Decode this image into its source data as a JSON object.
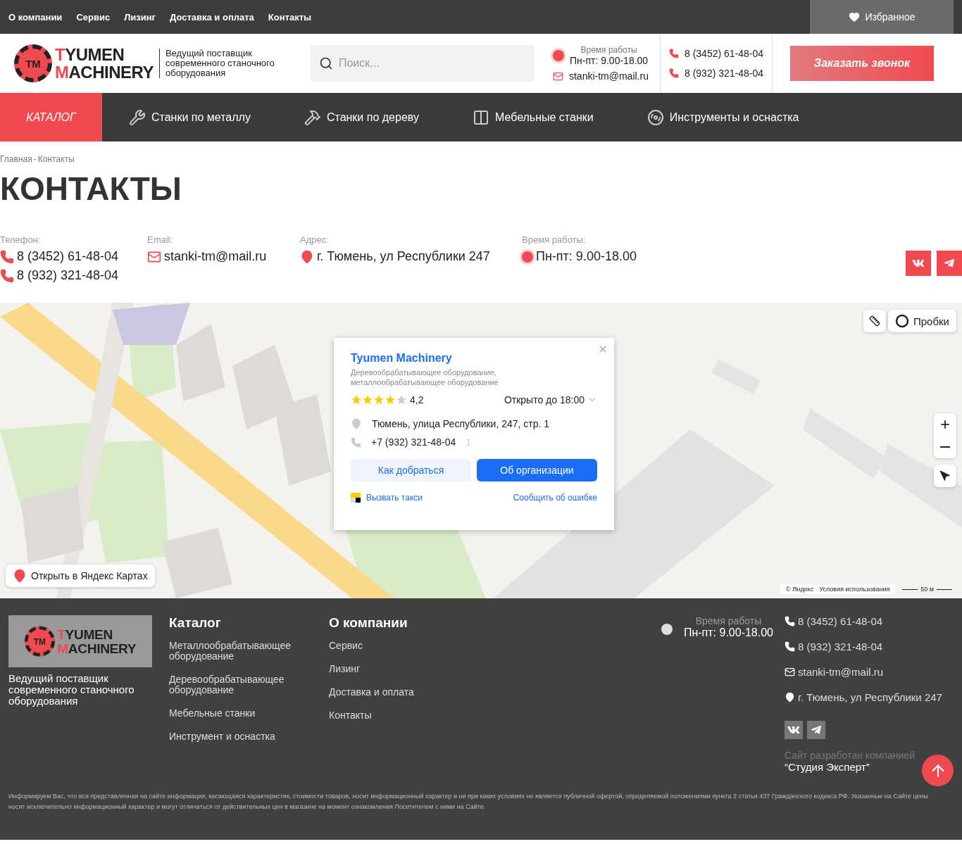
{
  "top_menu": [
    {
      "label": "О компании"
    },
    {
      "label": "Сервис"
    },
    {
      "label": "Лизинг"
    },
    {
      "label": "Доставка и оплата"
    },
    {
      "label": "Контакты"
    }
  ],
  "favorites": {
    "label": "Избранное"
  },
  "logo": {
    "badge": "TM",
    "line1": "TYUMEN",
    "line2": "MACHINERY"
  },
  "tagline": "Ведущий поставщик современного станочного оборудования",
  "search": {
    "placeholder": "Поиск..."
  },
  "work_hours": {
    "label": "Время работы",
    "value": "Пн-пт: 9.00-18.00"
  },
  "email": "stanki-tm@mail.ru",
  "phones": [
    "8 (3452) 61-48-04",
    "8 (932) 321-48-04"
  ],
  "callback_button": "Заказать звонок",
  "catalog_button": "КАТАЛОГ",
  "nav": [
    {
      "label": "Станки по металлу",
      "kind": "metal"
    },
    {
      "label": "Станки по дереву",
      "kind": "wood"
    },
    {
      "label": "Мебельные станки",
      "kind": "furniture"
    },
    {
      "label": "Инструменты и оснастка",
      "kind": "tools"
    }
  ],
  "breadcrumbs": {
    "items": [
      "Главная",
      "Контакты"
    ],
    "separator": "-"
  },
  "page_title": "КОНТАКТЫ",
  "contacts": [
    {
      "kind": "phone",
      "label": "Телефон:",
      "values": [
        "8 (3452) 61-48-04",
        "8 (932) 321-48-04"
      ]
    },
    {
      "kind": "email",
      "label": "Email:",
      "values": [
        "stanki-tm@mail.ru"
      ]
    },
    {
      "kind": "address",
      "label": "Адрес:",
      "values": [
        "г. Тюмень, ул Республики 247"
      ]
    },
    {
      "kind": "hours",
      "label": "Время работы:",
      "values": [
        "Пн-пт: 9.00-18.00"
      ]
    }
  ],
  "social": [
    {
      "kind": "vk"
    },
    {
      "kind": "telegram"
    }
  ],
  "map": {
    "kind": "picture",
    "org_card": {
      "title": "Tyumen Machinery",
      "description": "Деревообрабатывающее оборудование, металлообрабатывающее оборудование",
      "stars": 4,
      "rating": "4,2",
      "hours": "Открыто до 18:00",
      "address": "Тюмень, улица Республики, 247, стр. 1",
      "phone": "+7 (932) 321-48-04",
      "phone_count": "1",
      "buttons": [
        {
          "label": "Как добраться",
          "kind": "secondary"
        },
        {
          "label": "Об организации",
          "kind": "primary"
        }
      ],
      "taxi": "Вызвать такси",
      "report": "Сообщить об ошибке"
    },
    "traffic": "Пробки",
    "open_link": "Открыть в Яндекс Картах",
    "copyright": "© Яндекс",
    "terms": "Условия использования",
    "scale": "50 м"
  },
  "footer": {
    "logo": {
      "badge": "TM",
      "line1": "TYUMEN",
      "line2": "MACHINERY"
    },
    "tagline": "Ведущий поставщик современного станочного оборудования",
    "columns": [
      {
        "title": "Каталог",
        "links": [
          "Металлообрабатывающее оборудование",
          "Деревообрабатывающее оборудование",
          "Мебельные станки",
          "Инструмент и оснастка"
        ]
      },
      {
        "title": "О компании",
        "links": [
          "Сервис",
          "Лизинг",
          "Доставка и оплата",
          "Контакты"
        ]
      }
    ],
    "work_hours": {
      "label": "Время работы",
      "value": "Пн-пт: 9.00-18.00"
    },
    "contacts": [
      {
        "kind": "phone",
        "text": "8 (3452) 61-48-04"
      },
      {
        "kind": "phone",
        "text": "8 (932) 321-48-04"
      },
      {
        "kind": "email",
        "text": "stanki-tm@mail.ru"
      },
      {
        "kind": "address",
        "text": "г. Тюмень, ул Республики 247"
      }
    ],
    "social": [
      {
        "kind": "vk"
      },
      {
        "kind": "telegram"
      }
    ],
    "developer": {
      "line1": "Сайт разработан компанией",
      "line2": "“Студия Эксперт”"
    },
    "disclaimer": "Информируем Вас, что вся представленная на сайте информация, касающаяся характеристик, стоимости товаров, носит информационный характер и ни при каких условиях не является публичной офертой, определяемой положениями пункта 2 статьи 437 Гражданского кодекса РФ. Указанные на Сайте цены носят исключительно информационный характер и могут отличаться от действительных цен в магазине на момент ознакомления Посетителем с ними на Сайте."
  }
}
